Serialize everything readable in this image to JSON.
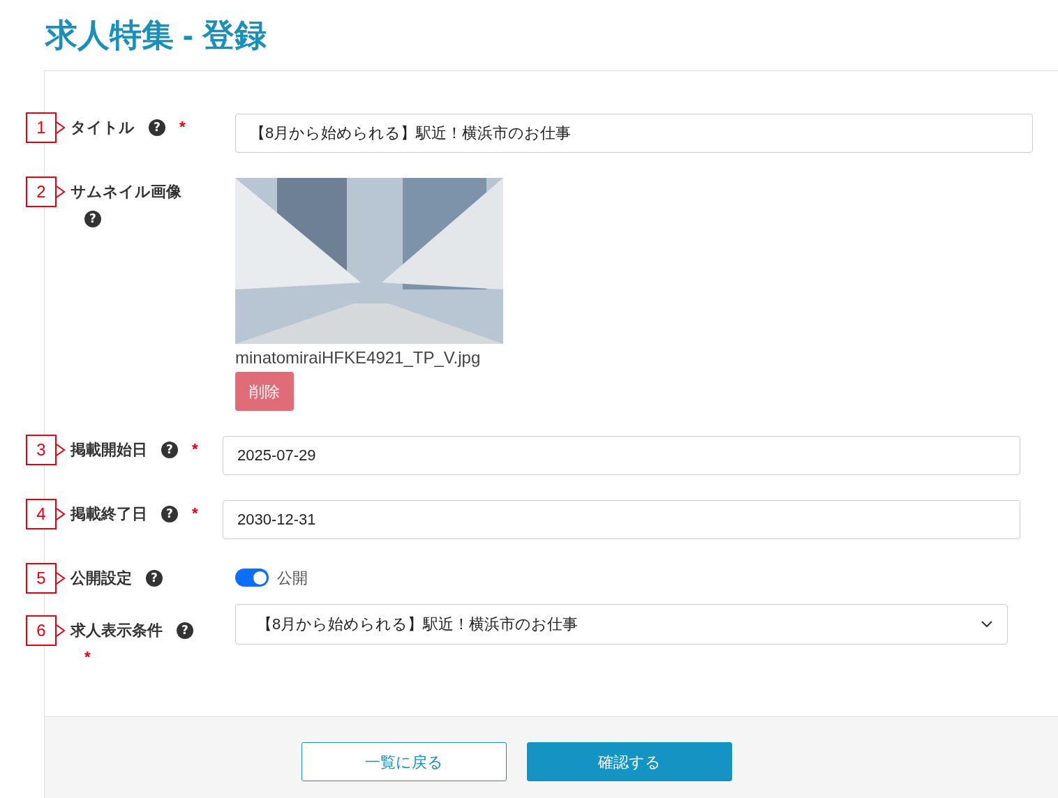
{
  "page_title": "求人特集 - 登録",
  "fields": [
    {
      "marker": "1",
      "label": "タイトル",
      "help": "?",
      "required": "*",
      "kind": "text",
      "value": "【8月から始められる】駅近！横浜市のお仕事"
    },
    {
      "marker": "2",
      "label": "サムネイル画像",
      "help": "?",
      "kind": "image",
      "filename": "minatomiraiHFKE4921_TP_V.jpg",
      "delete_label": "削除"
    },
    {
      "marker": "3",
      "label": "掲載開始日",
      "help": "?",
      "required": "*",
      "kind": "date",
      "value": "2025-07-29"
    },
    {
      "marker": "4",
      "label": "掲載終了日",
      "help": "?",
      "required": "*",
      "kind": "date",
      "value": "2030-12-31"
    },
    {
      "marker": "5",
      "label": "公開設定",
      "help": "?",
      "kind": "toggle",
      "on": true,
      "toggle_label": "公開"
    },
    {
      "marker": "6",
      "label": "求人表示条件",
      "help": "?",
      "required": "*",
      "kind": "select",
      "value": "【8月から始められる】駅近！横浜市のお仕事"
    }
  ],
  "buttons": [
    {
      "label": "一覧に戻る",
      "kind": "secondary"
    },
    {
      "label": "確認する",
      "kind": "primary"
    }
  ]
}
